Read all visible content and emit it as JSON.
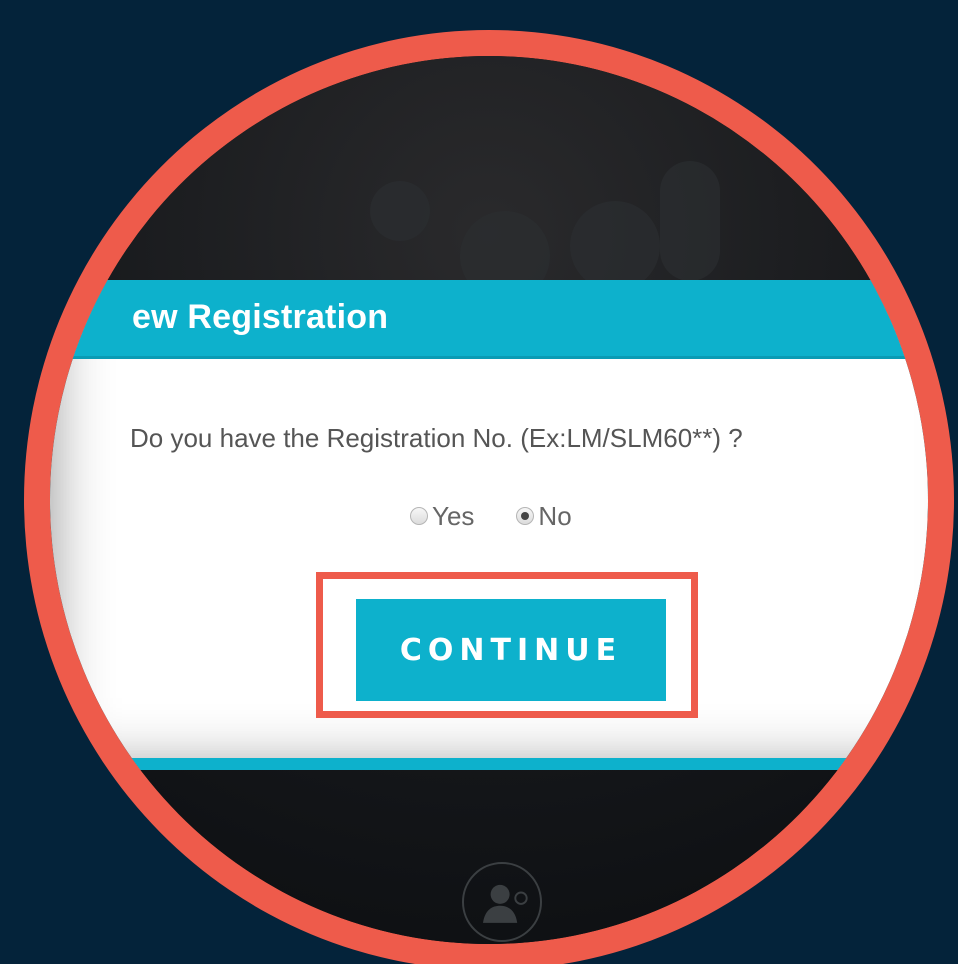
{
  "dialog": {
    "title": "ew Registration",
    "question": "Do you have the Registration No. (Ex:LM/SLM60**) ?",
    "options": [
      {
        "label": "Yes",
        "checked": false
      },
      {
        "label": "No",
        "checked": true
      }
    ],
    "continue_label": "CONTINUE"
  },
  "colors": {
    "background": "#04233a",
    "accent": "#0db1cc",
    "highlight": "#ee5b4b"
  },
  "icons": {
    "bottom": "doctor-avatar-icon"
  }
}
